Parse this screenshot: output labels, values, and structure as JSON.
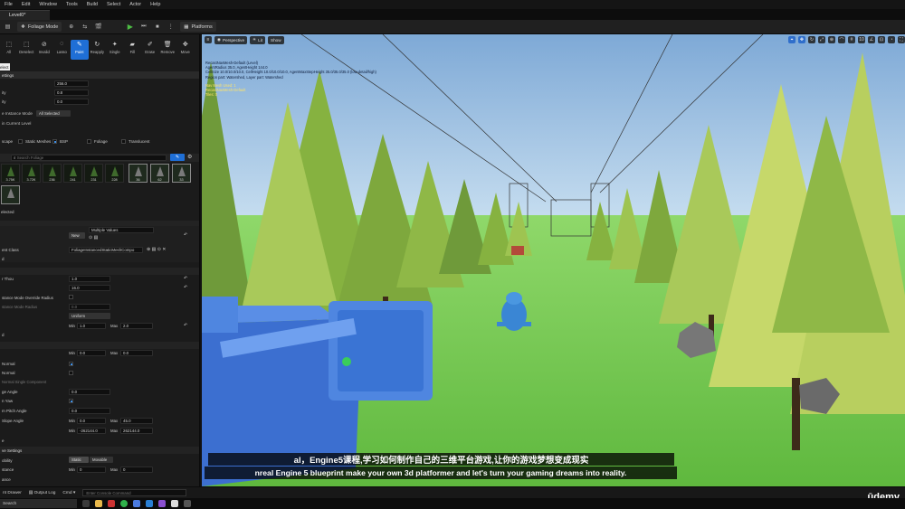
{
  "menu": [
    "File",
    "Edit",
    "Window",
    "Tools",
    "Build",
    "Select",
    "Actor",
    "Help"
  ],
  "level_tab": "Level0*",
  "toolbar": {
    "mode_dropdown": "Foliage Mode",
    "platforms": "Platforms"
  },
  "foliage_tools": [
    "All",
    "Deselect",
    "Invalid",
    "Lasso",
    "Paint",
    "Reapply",
    "Single",
    "Fill",
    "Erase",
    "Remove",
    "Move"
  ],
  "tooltip": "elect",
  "panel": {
    "settings_header": "ettings",
    "rows": [
      {
        "label": "",
        "value": "256.0"
      },
      {
        "label": "ity",
        "value": "0.8"
      },
      {
        "label": "ity",
        "value": "0.0"
      }
    ],
    "instance_mode_label": "e Instance Mode",
    "instance_mode_value": "All Selected",
    "current_level_label": "in Current Level",
    "filters": [
      "scape",
      "Static Meshes",
      "BSP",
      "Foliage",
      "Translucent"
    ],
    "search_placeholder": "Search Foliage",
    "foliage_counts": [
      "3.75K",
      "3.72K",
      "236",
      "241",
      "231",
      "228",
      "36",
      "62",
      "33"
    ],
    "selected_label": "elected",
    "mesh_new": "New",
    "mesh_multiple": "Multiple Values",
    "component_class_label": "ent Class",
    "component_class_value": "FoliageInstancedStaticMeshCompo",
    "rows2": [
      {
        "label": "r Thou",
        "min": "1.0"
      },
      {
        "label": "",
        "min": "16.0"
      },
      {
        "label": "stance Mode Override Radius",
        "min": ""
      },
      {
        "label": "stance Mode Radius",
        "min": "0.0"
      }
    ],
    "uniform_value": "Uniform",
    "scale_min_label": "Min",
    "scale_min": "1.0",
    "scale_max_label": "Max",
    "scale_max": "2.0",
    "ranges": [
      {
        "label": "",
        "min": "0.0",
        "max": "0.0"
      },
      {
        "label": "",
        "min": "0.0",
        "max": "0.0"
      }
    ],
    "normal_label": "Normal",
    "normal2_label": "Normal",
    "normal_single_label": "Normal Single Component",
    "angle_label": "ge Angle",
    "angle_value": "0.0",
    "yaw_label": "n Yaw",
    "pitch_label": "m Pitch Angle",
    "pitch_value": "0.0",
    "slope_label": "Slope Angle",
    "slope_min": "0.0",
    "slope_max": "45.0",
    "height_min": "-262144.0",
    "height_max": "262144.0",
    "settings_section": "ve Settings",
    "mobility_label": "obility",
    "static_btn": "Static",
    "movable_btn": "Movable",
    "instances_label": "stance",
    "instances_min": "0",
    "instances_max": "0"
  },
  "viewport": {
    "perspective": "Perspective",
    "lit": "Lit",
    "show": "Show",
    "stats_lines": [
      "RecastNavMesh-Default (Level)",
      "AgentRadius 35.0, AgentHeight 144.0",
      "CellSize 10.0/10.0/10.0, CellHeight 10.0/10.0/10.0, AgentMaxStepHeight 35.0/35.0/35.0 (low-detail/high)",
      "Region part: Watershed, Layer part: Watershed"
    ],
    "stats_lines2": [
      "Nav Mesh Used: 1",
      "RecastNavMesh-Default",
      "Tiles: 0"
    ]
  },
  "subtitles": {
    "cn": "al，Engine5课程,学习如何制作自己的三维平台游戏,让你的游戏梦想变成现实",
    "en": "nreal Engine 5 blueprint make your own 3d platformer and let's turn your gaming dreams into reality."
  },
  "bottom": {
    "content_drawer": "nt Drawer",
    "output_log": "Output Log",
    "cmd": "Cmd",
    "cmd_placeholder": "Enter Console Command"
  },
  "taskbar_search": "Search",
  "watermark": "ūdemy",
  "colors": {
    "accent": "#1f6fd6",
    "panel_bg": "#1b1b1b",
    "sky": "#8fb8df",
    "grass": "#7fd35a"
  }
}
